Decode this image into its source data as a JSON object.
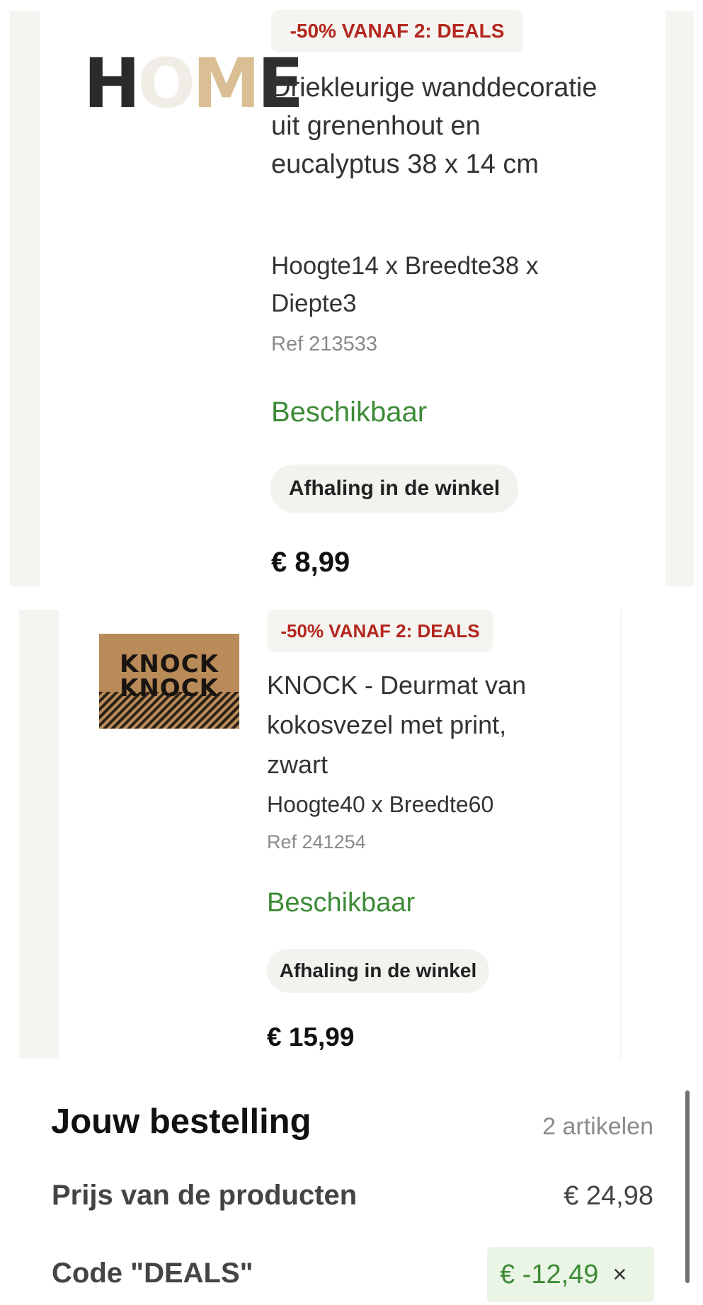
{
  "products": [
    {
      "badge": "-50% VANAF 2: DEALS",
      "title": "Driekleurige wanddecoratie uit grenenhout en eucalyptus 38 x 14 cm",
      "dimensions": "Hoogte14 x Breedte38 x Diepte3",
      "ref": "Ref 213533",
      "availability": "Beschikbaar",
      "delivery": "Afhaling in de winkel",
      "price": "€ 8,99",
      "image_letters": [
        "H",
        "O",
        "M",
        "E"
      ]
    },
    {
      "badge": "-50% VANAF 2: DEALS",
      "title": "KNOCK - Deurmat van kokosvezel met print, zwart",
      "dimensions": "Hoogte40 x Breedte60",
      "ref": "Ref 241254",
      "availability": "Beschikbaar",
      "delivery": "Afhaling in de winkel",
      "price": "€ 15,99",
      "image_text": [
        "KNOCK",
        "KNOCK"
      ]
    }
  ],
  "summary": {
    "title": "Jouw bestelling",
    "count": "2 artikelen",
    "products_label": "Prijs van de producten",
    "products_value": "€ 24,98",
    "code_label": "Code \"DEALS\"",
    "code_value": "€ -12,49",
    "remove_symbol": "×"
  },
  "colors": {
    "badge_text": "#b3261e",
    "availability": "#3d8b37",
    "discount_bg": "#eaf5e6"
  }
}
